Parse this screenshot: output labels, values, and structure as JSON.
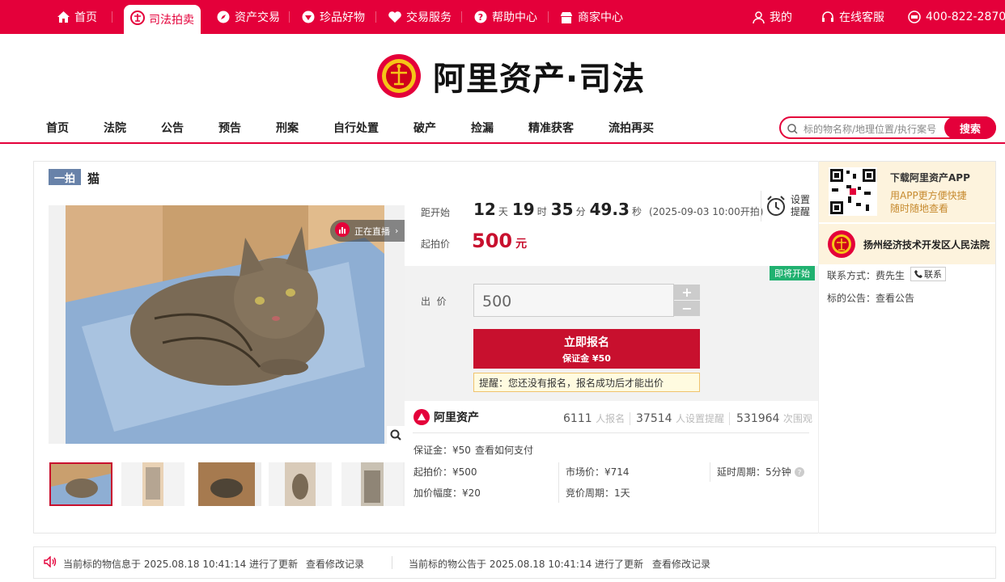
{
  "topnav": {
    "items": [
      "首页",
      "司法拍卖",
      "资产交易",
      "珍品好物",
      "交易服务",
      "帮助中心",
      "商家中心"
    ],
    "mine": "我的",
    "service": "在线客服",
    "phone": "400-822-2870"
  },
  "brand": {
    "title": "阿里资产·司法"
  },
  "catnav": {
    "items": [
      "首页",
      "法院",
      "公告",
      "预告",
      "刑案",
      "自行处置",
      "破产",
      "捡漏",
      "精准获客",
      "流拍再买"
    ]
  },
  "search": {
    "placeholder": "标的物名称/地理位置/执行案号",
    "button": "搜索"
  },
  "item": {
    "badge": "一拍",
    "title": "猫",
    "live": "正在直播",
    "countdown_label": "距开始",
    "days": "12",
    "days_unit": "天",
    "hours": "19",
    "hours_unit": "时",
    "minutes": "35",
    "minutes_unit": "分",
    "seconds": "49.3",
    "seconds_unit": "秒",
    "start_time": "(2025-09-03 10:00开拍)",
    "reminder": "设置提醒",
    "start_price_label": "起拍价",
    "start_price": "500",
    "price_unit": "元",
    "soon_badge": "即将开始",
    "bid_label": "出  价",
    "bid_value": "500",
    "plus": "+",
    "minus": "−",
    "signup_title": "立即报名",
    "signup_deposit": "保证金 ¥50",
    "notice": "提醒：您还没有报名，报名成功后才能出价"
  },
  "stats": {
    "brand": "阿里资产",
    "registered": "6111",
    "registered_unit": "人报名",
    "reminders": "37514",
    "reminders_unit": "人设置提醒",
    "views": "531964",
    "views_unit": "次围观"
  },
  "details": {
    "deposit": "保证金：¥50",
    "how_to_pay": "查看如何支付",
    "start_price": "起拍价：¥500",
    "market_price": "市场价：¥714",
    "delay": "延时周期：5分钟",
    "increment": "加价幅度：¥20",
    "cycle": "竞价周期：1天"
  },
  "sidebar": {
    "app_title": "下载阿里资产APP",
    "app_line1": "用APP更方便快捷",
    "app_line2": "随时随地查看",
    "court_name": "扬州经济技术开发区人民法院",
    "contact_label": "联系方式：",
    "contact_person": "费先生",
    "contact_button": "联系",
    "notice_label": "标的公告：",
    "notice_link": "查看公告"
  },
  "bottom": {
    "info_update": "当前标的物信息于 2025.08.18 10:41:14 进行了更新",
    "info_link": "查看修改记录",
    "notice_update": "当前标的物公告于 2025.08.18 10:41:14 进行了更新",
    "notice_link": "查看修改记录"
  },
  "colors": {
    "brand_red": "#e4003a",
    "price_red": "#c8102e",
    "badge_blue": "#6882a9",
    "soon_green": "#20b170",
    "link_blue": "#1a66c9"
  }
}
